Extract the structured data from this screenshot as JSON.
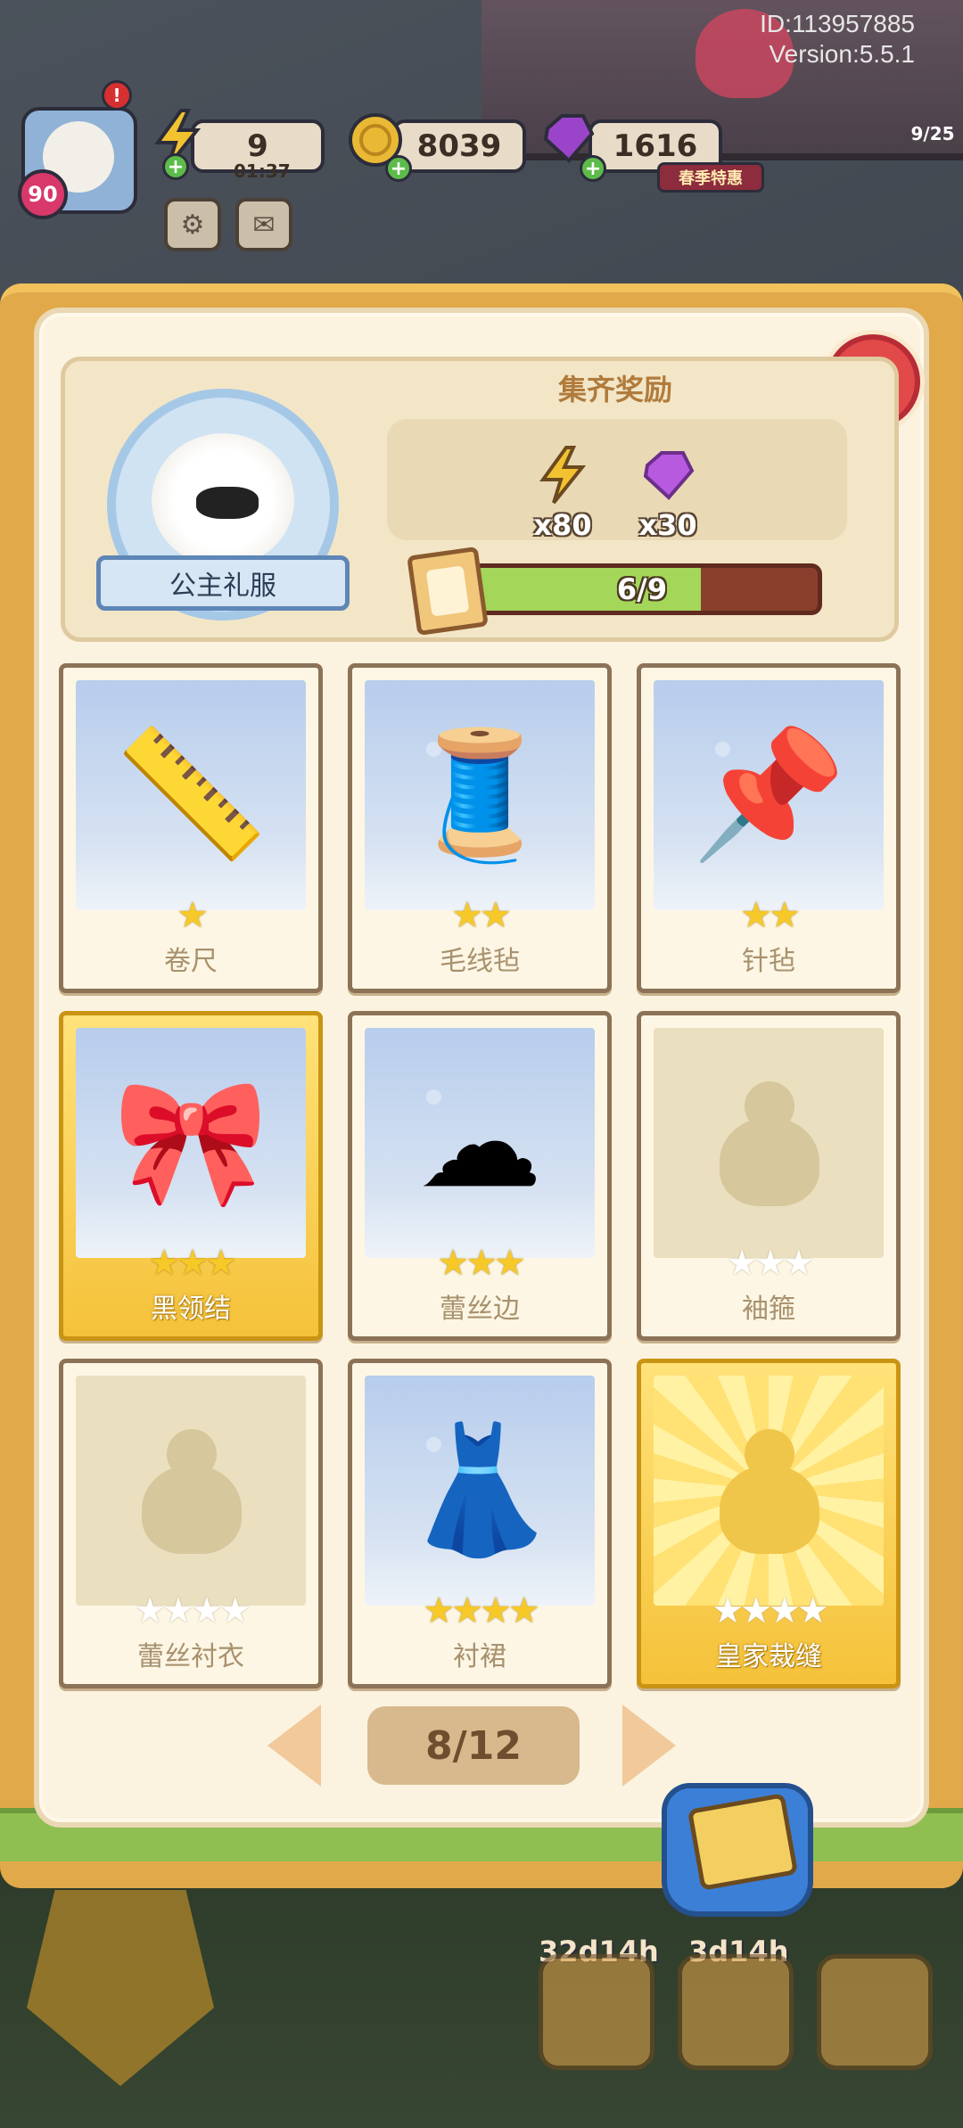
{
  "hud": {
    "id_text": "ID:113957885",
    "version_text": "Version:5.5.1",
    "level": "90",
    "alert": "!",
    "energy": "9",
    "energy_timer": "01:37",
    "coins": "8039",
    "gems": "1616",
    "offer_tag": "春季特惠",
    "side_progress": "9/25"
  },
  "set": {
    "name": "公主礼服",
    "reward_title": "集齐奖励",
    "rewards": [
      {
        "icon": "lightning-icon",
        "qty": "x80"
      },
      {
        "icon": "gem-icon",
        "qty": "x30"
      }
    ],
    "progress_text": "6/9",
    "progress_fraction": 0.667
  },
  "cards": [
    {
      "name": "卷尺",
      "stars": 1,
      "filled": 1,
      "state": "owned",
      "glyph": "📏",
      "icon": "tape-measure-icon"
    },
    {
      "name": "毛线毡",
      "stars": 2,
      "filled": 2,
      "state": "owned",
      "glyph": "🧵",
      "icon": "thread-spool-icon"
    },
    {
      "name": "针毡",
      "stars": 2,
      "filled": 2,
      "state": "owned",
      "glyph": "📌",
      "icon": "pin-cushion-icon"
    },
    {
      "name": "黑领结",
      "stars": 3,
      "filled": 3,
      "state": "gold",
      "glyph": "🎀",
      "icon": "bow-tie-icon"
    },
    {
      "name": "蕾丝边",
      "stars": 3,
      "filled": 3,
      "state": "owned",
      "glyph": "☁",
      "icon": "lace-trim-icon"
    },
    {
      "name": "袖箍",
      "stars": 3,
      "filled": 0,
      "state": "locked",
      "glyph": "",
      "icon": "locked-silhouette-icon"
    },
    {
      "name": "蕾丝衬衣",
      "stars": 4,
      "filled": 0,
      "state": "locked",
      "glyph": "",
      "icon": "locked-silhouette-icon"
    },
    {
      "name": "衬裙",
      "stars": 4,
      "filled": 4,
      "state": "owned",
      "glyph": "👗",
      "icon": "petticoat-icon"
    },
    {
      "name": "皇家裁缝",
      "stars": 4,
      "filled": 0,
      "state": "gold-locked",
      "glyph": "",
      "icon": "gold-silhouette-icon"
    }
  ],
  "pager": {
    "label": "8/12"
  },
  "bottom": {
    "slot1_label": "32d14h",
    "slot2_label": "3d14h"
  }
}
